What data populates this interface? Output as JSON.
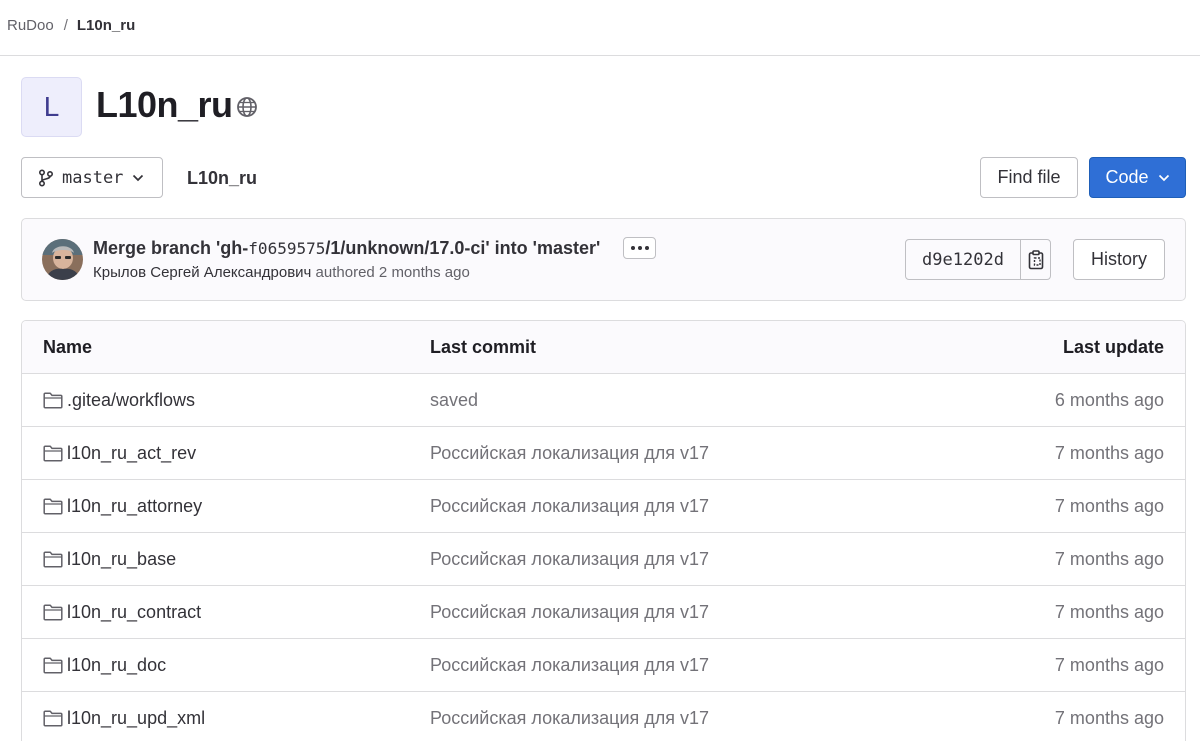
{
  "breadcrumb": {
    "group": "RuDoo",
    "separator": "/",
    "project": "L10n_ru"
  },
  "project": {
    "avatar_letter": "L",
    "title": "L10n_ru",
    "visibility_icon": "globe-icon"
  },
  "toolbar": {
    "branch": "master",
    "path": "L10n_ru",
    "find_file_label": "Find file",
    "code_label": "Code"
  },
  "commit": {
    "title_prefix": "Merge branch 'gh-",
    "title_hash": "f0659575",
    "title_suffix": "/1/unknown/17.0-ci' into 'master'",
    "author": "Крылов Сергей Александрович",
    "authored_text": "authored 2 months ago",
    "sha": "d9e1202d",
    "history_label": "History"
  },
  "table": {
    "headers": {
      "name": "Name",
      "last_commit": "Last commit",
      "last_update": "Last update"
    },
    "rows": [
      {
        "name": ".gitea/workflows",
        "last_commit": "saved",
        "last_update": "6 months ago"
      },
      {
        "name": "l10n_ru_act_rev",
        "last_commit": "Российская локализация для v17",
        "last_update": "7 months ago"
      },
      {
        "name": "l10n_ru_attorney",
        "last_commit": "Российская локализация для v17",
        "last_update": "7 months ago"
      },
      {
        "name": "l10n_ru_base",
        "last_commit": "Российская локализация для v17",
        "last_update": "7 months ago"
      },
      {
        "name": "l10n_ru_contract",
        "last_commit": "Российская локализация для v17",
        "last_update": "7 months ago"
      },
      {
        "name": "l10n_ru_doc",
        "last_commit": "Российская локализация для v17",
        "last_update": "7 months ago"
      },
      {
        "name": "l10n_ru_upd_xml",
        "last_commit": "Российская локализация для v17",
        "last_update": "7 months ago"
      }
    ]
  },
  "colors": {
    "primary": "#2f6fd6",
    "avatar_bg": "#eeeefc",
    "avatar_text": "#3f3c8f",
    "muted_text": "#737278",
    "border": "#dcdcde"
  }
}
